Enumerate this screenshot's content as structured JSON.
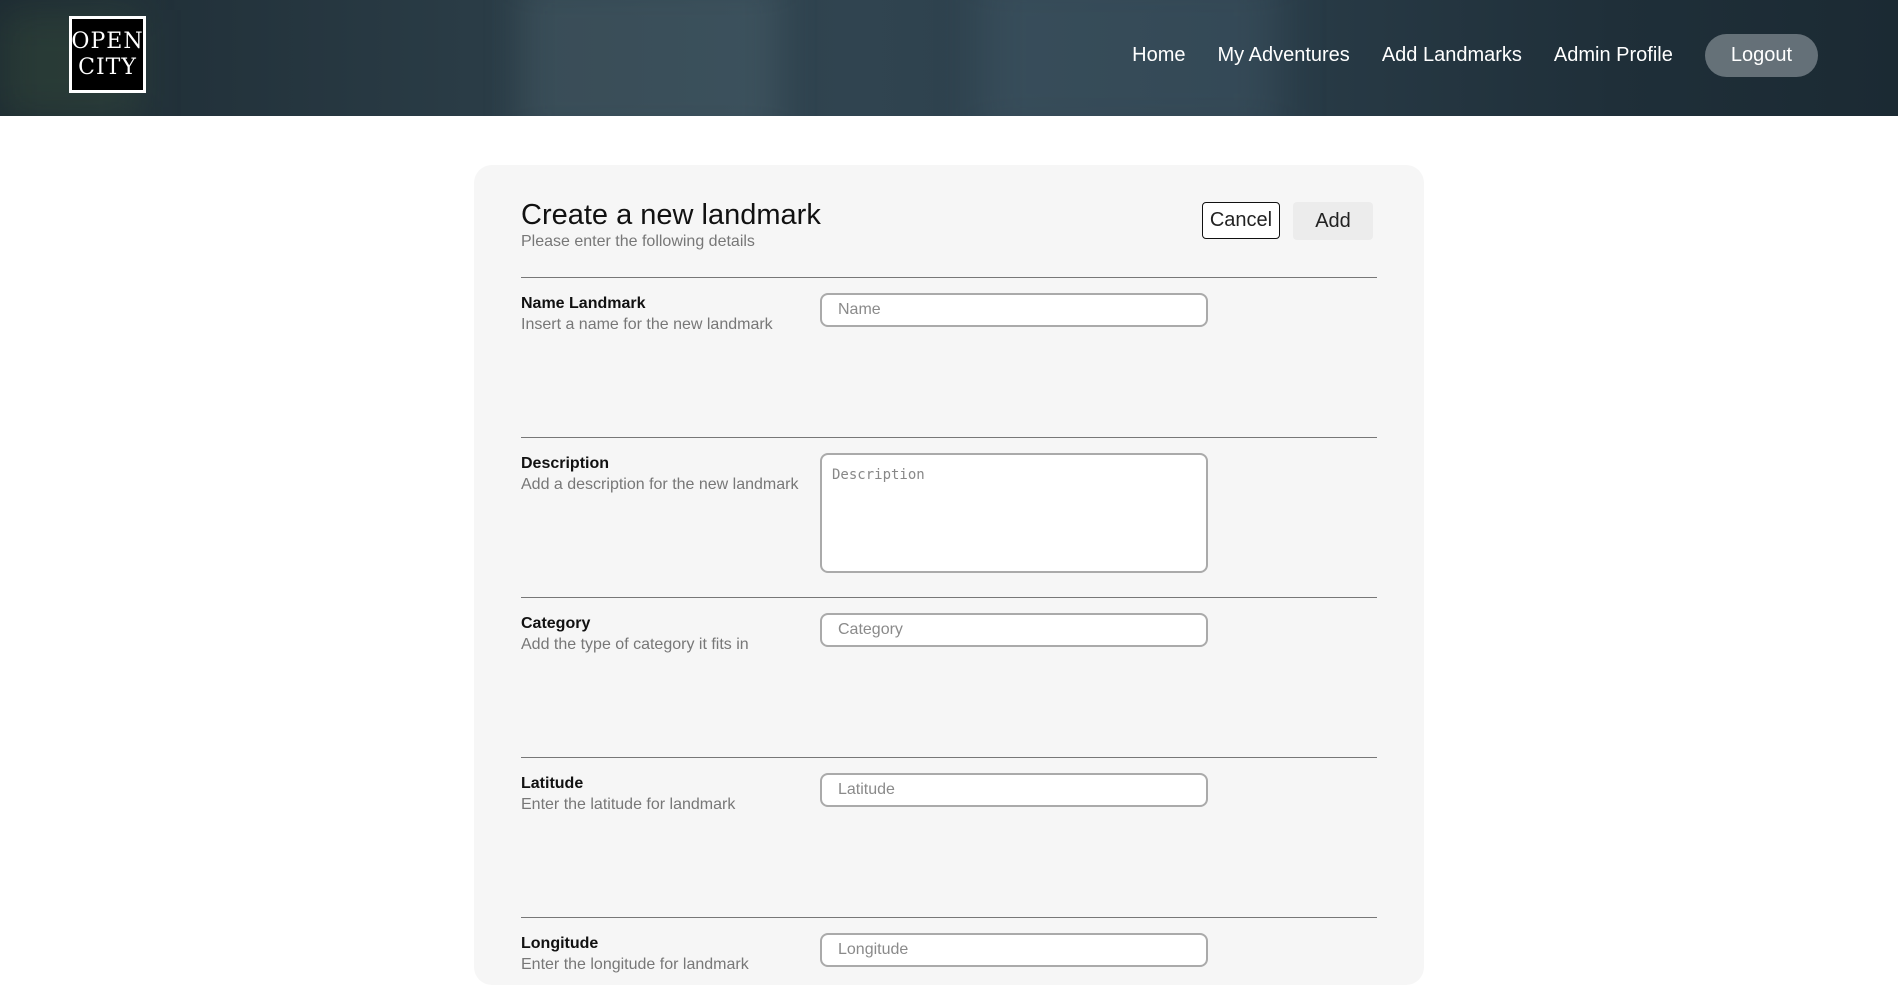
{
  "header": {
    "logo": {
      "line1": "OPEN",
      "line2": "CITY"
    },
    "nav": [
      "Home",
      "My Adventures",
      "Add Landmarks",
      "Admin Profile"
    ],
    "logout_label": "Logout"
  },
  "form": {
    "title": "Create a new landmark",
    "subtitle": "Please enter the following details",
    "cancel_label": "Cancel",
    "add_label": "Add",
    "fields": [
      {
        "label": "Name Landmark",
        "hint": "Insert a name for the new landmark",
        "placeholder": "Name",
        "value": ""
      },
      {
        "label": "Description",
        "hint": "Add a description for the new landmark",
        "placeholder": "Description",
        "value": ""
      },
      {
        "label": "Category",
        "hint": "Add the type of category it fits in",
        "placeholder": "Category",
        "value": ""
      },
      {
        "label": "Latitude",
        "hint": "Enter the latitude for landmark",
        "placeholder": "Latitude",
        "value": ""
      },
      {
        "label": "Longitude",
        "hint": "Enter the longitude for landmark",
        "placeholder": "Longitude",
        "value": ""
      }
    ]
  },
  "colors": {
    "header_bg": "#26363f",
    "card_bg": "#f6f6f6",
    "logout_bg": "#8f979b"
  }
}
